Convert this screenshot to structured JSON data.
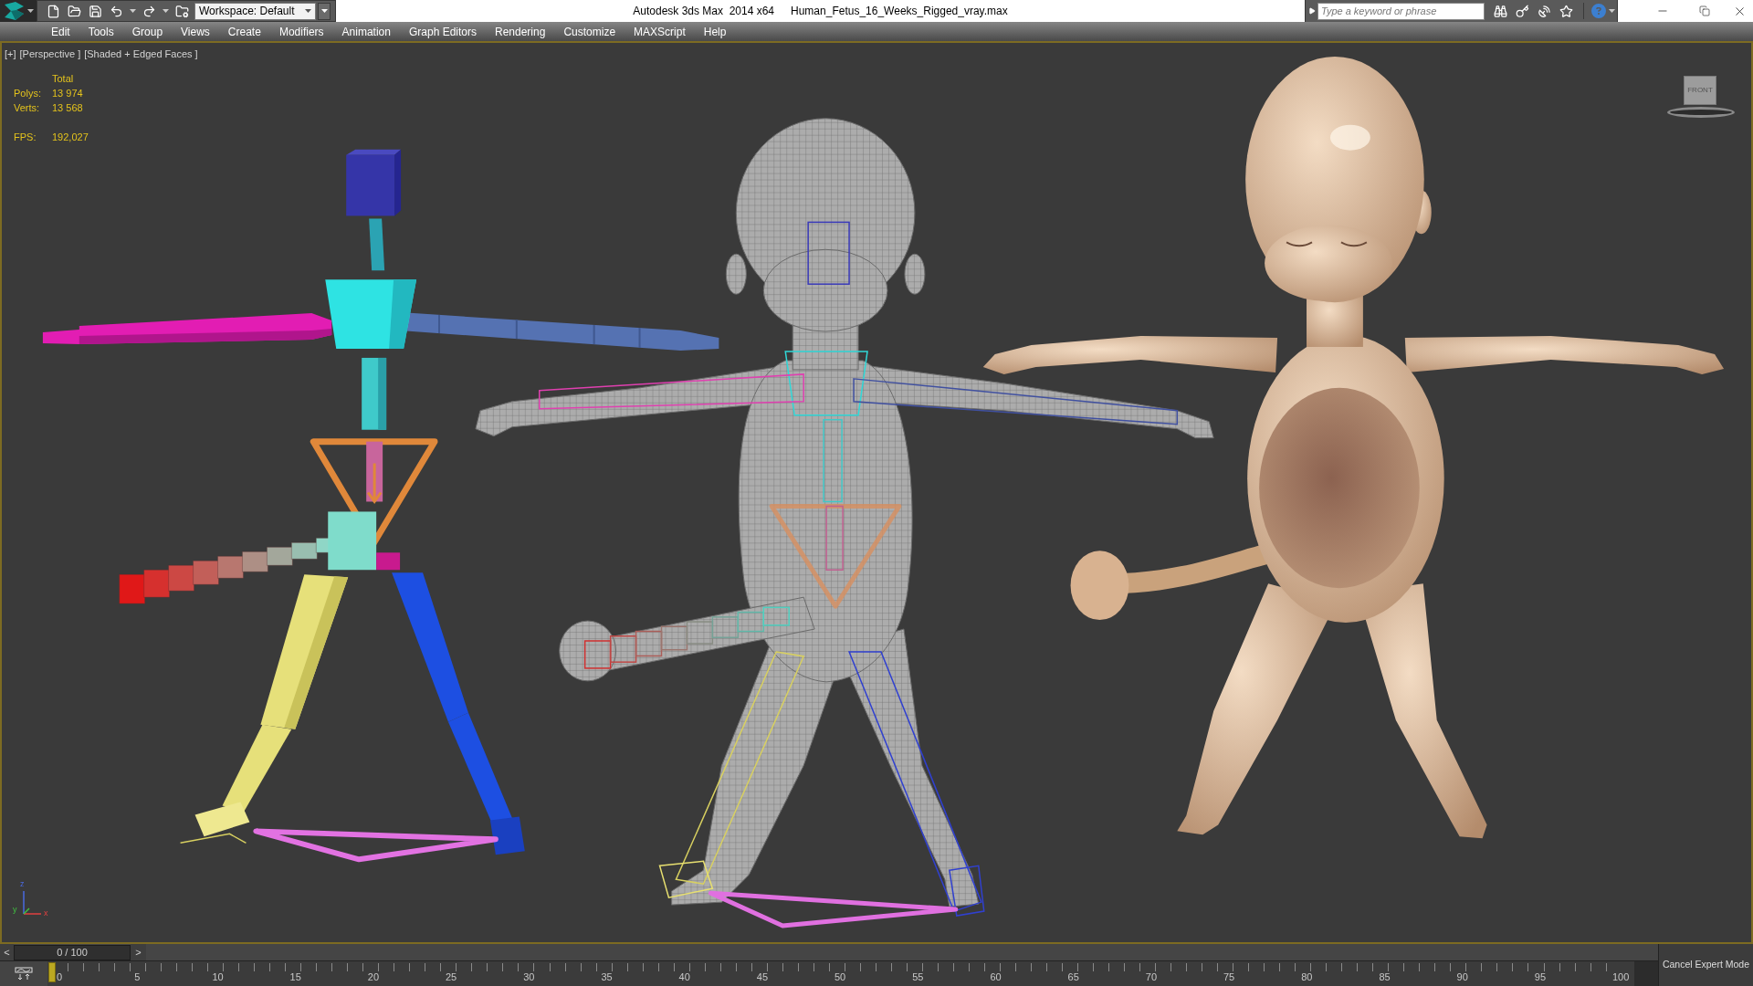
{
  "title_bar": {
    "workspace": "Workspace: Default",
    "title": "Autodesk 3ds Max  2014 x64",
    "file_name": "Human_Fetus_16_Weeks_Rigged_vray.max",
    "search": {
      "placeholder": "Type a keyword or phrase"
    }
  },
  "menu_bar": [
    "Edit",
    "Tools",
    "Group",
    "Views",
    "Create",
    "Modifiers",
    "Animation",
    "Graph Editors",
    "Rendering",
    "Customize",
    "MAXScript",
    "Help"
  ],
  "viewport": {
    "labels": [
      "[+]",
      "[Perspective ]",
      "[Shaded + Edged Faces ]"
    ],
    "stats": {
      "header": "Total",
      "rows": [
        {
          "label": "Polys:",
          "value": "13 974"
        },
        {
          "label": "Verts:",
          "value": "13 568"
        }
      ],
      "fps": {
        "label": "FPS:",
        "value": "192,027"
      }
    },
    "viewcube": {
      "face": "FRONT"
    },
    "axis_labels": {
      "z": "z",
      "y": "y",
      "x": "x"
    }
  },
  "time_slider": {
    "prev": "<",
    "position": "0 / 100",
    "next": ">",
    "level": 0
  },
  "track_bar": {
    "level": 0,
    "ticks": [
      "0",
      "5",
      "10",
      "15",
      "20",
      "25",
      "30",
      "35",
      "40",
      "45",
      "50",
      "55",
      "60",
      "65",
      "70",
      "75",
      "80",
      "85",
      "90",
      "95",
      "100"
    ]
  },
  "expert_mode_button": "Cancel Expert Mode"
}
